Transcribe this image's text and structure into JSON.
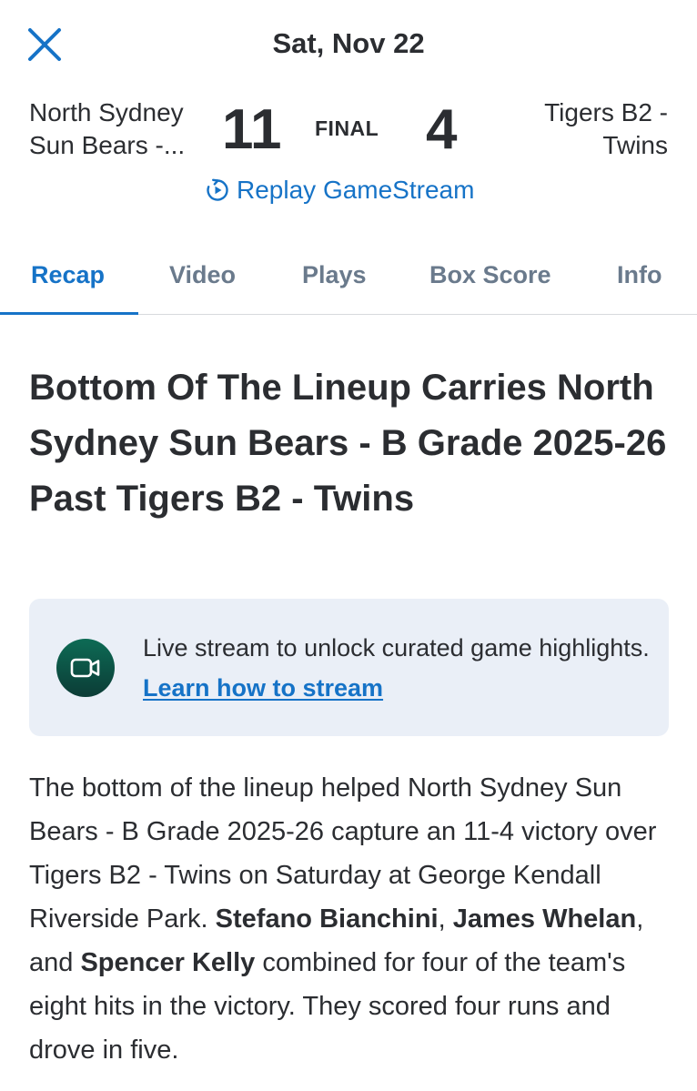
{
  "header": {
    "date": "Sat, Nov 22"
  },
  "game": {
    "home_team": "North Sydney Sun Bears -...",
    "home_score": "11",
    "status": "FINAL",
    "away_score": "4",
    "away_team": "Tigers B2 - Twins",
    "replay_label": "Replay GameStream"
  },
  "tabs": [
    {
      "label": "Recap",
      "active": true
    },
    {
      "label": "Video",
      "active": false
    },
    {
      "label": "Plays",
      "active": false
    },
    {
      "label": "Box Score",
      "active": false
    },
    {
      "label": "Info",
      "active": false
    }
  ],
  "article": {
    "headline": "Bottom Of The Lineup Carries North Sydney Sun Bears - B Grade 2025-26 Past Tigers B2 - Twins",
    "promo_text": "Live stream to unlock curated game highlights.",
    "promo_link": "Learn how to stream",
    "body_part1": "The bottom of the lineup helped North Sydney Sun Bears - B Grade 2025-26 capture an 11-4 victory over Tigers B2 - Twins on Saturday at George Kendall Riverside Park. ",
    "player1": "Stefano Bianchini",
    "sep1": ", ",
    "player2": "James Whelan",
    "sep2": ", and ",
    "player3": "Spencer Kelly",
    "body_part2": " combined for four of the team's eight hits in the victory. They scored four runs and drove in five."
  },
  "colors": {
    "accent": "#1673c7",
    "text": "#2b2d31",
    "tab_inactive": "#6a7a8c",
    "promo_bg": "#eaeff7",
    "icon_bg": "#0c4a40"
  },
  "icons": {
    "close": "close-icon",
    "replay": "replay-icon",
    "video_camera": "video-camera-icon"
  }
}
